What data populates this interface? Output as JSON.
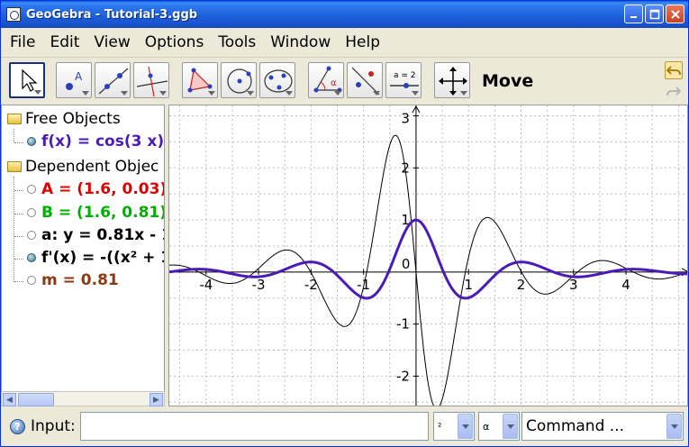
{
  "window": {
    "title": "GeoGebra - Tutorial-3.ggb",
    "minimize": "_",
    "maximize": "□",
    "close": "✕"
  },
  "menu": [
    "File",
    "Edit",
    "View",
    "Options",
    "Tools",
    "Window",
    "Help"
  ],
  "toolbar": {
    "mode_label": "Move",
    "slider_tool_text": "a = 2",
    "angle_tool_text": "α",
    "point_tool_text": "A",
    "tools": [
      "move-tool",
      "new-point-tool",
      "line-tool",
      "perpendicular-line-tool",
      "polygon-tool",
      "circle-tool",
      "conic-tool",
      "angle-tool",
      "reflect-tool",
      "slider-tool",
      "move-view-tool"
    ]
  },
  "algebra": {
    "free_header": "Free Objects",
    "dependent_header": "Dependent Objec",
    "free_objects": [
      {
        "text": "f(x) = cos(3 x)",
        "color": "#4B1BB8",
        "bullet": "filled"
      }
    ],
    "dependent_objects": [
      {
        "text": "A = (1.6, 0.03)",
        "color": "#E00000",
        "bullet": "hollow"
      },
      {
        "text": "B = (1.6, 0.81)",
        "color": "#00B000",
        "bullet": "hollow"
      },
      {
        "text": "a: y = 0.81x - 1",
        "color": "#000000",
        "bullet": "hollow"
      },
      {
        "text": "f'(x) = -((x² + 1",
        "color": "#000000",
        "bullet": "filled"
      },
      {
        "text": "m = 0.81",
        "color": "#8B3A10",
        "bullet": "hollow"
      }
    ]
  },
  "graphics": {
    "x_ticks": [
      "-4",
      "-3",
      "-2",
      "-1",
      "0",
      "1",
      "2",
      "3",
      "4"
    ],
    "y_ticks": [
      "3",
      "2",
      "1",
      "0",
      "-1",
      "-2"
    ],
    "xlim": [
      -4.7,
      5.2
    ],
    "ylim": [
      -2.6,
      3.2
    ],
    "grid": true,
    "f_color": "#4B1BB8",
    "fprime_color": "#000000"
  },
  "input": {
    "label": "Input:",
    "help": "?",
    "value": "",
    "exponent_combo": "²",
    "greek_combo": "α",
    "command_combo": "Command ..."
  }
}
